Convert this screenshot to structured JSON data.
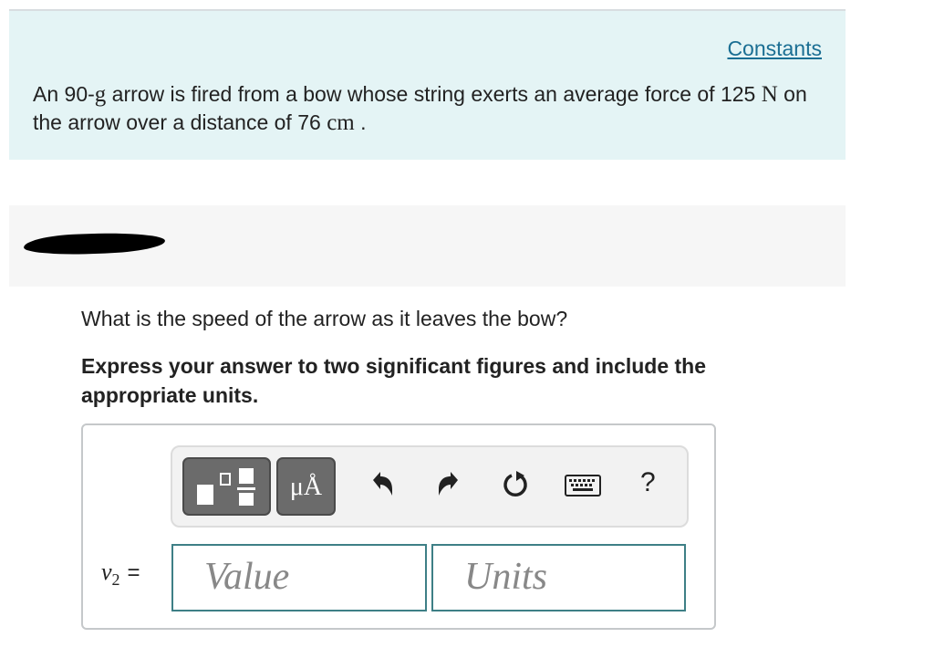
{
  "header": {
    "constants_link": "Constants",
    "problem": {
      "part1": "An 90-",
      "mass_unit": "g",
      "part2": " arrow is fired from a bow whose string exerts an average force of ",
      "force_value": "125",
      "force_unit": "N",
      "part3": " on the arrow over a distance of 76 ",
      "distance_unit": "cm",
      "part4": " ."
    }
  },
  "question": {
    "text": "What is the speed of the arrow as it leaves the bow?",
    "instruction": "Express your answer to two significant figures and include the appropriate units."
  },
  "toolbar": {
    "units_button_label": "μÅ",
    "help_label": "?"
  },
  "answer": {
    "variable": "v",
    "subscript": "2",
    "equals": "=",
    "value_placeholder": "Value",
    "units_placeholder": "Units"
  },
  "colors": {
    "panel_bg": "#e4f4f5",
    "link": "#1a6e93",
    "field_border": "#3e7f86",
    "toolbar_button": "#6b6b6b"
  }
}
